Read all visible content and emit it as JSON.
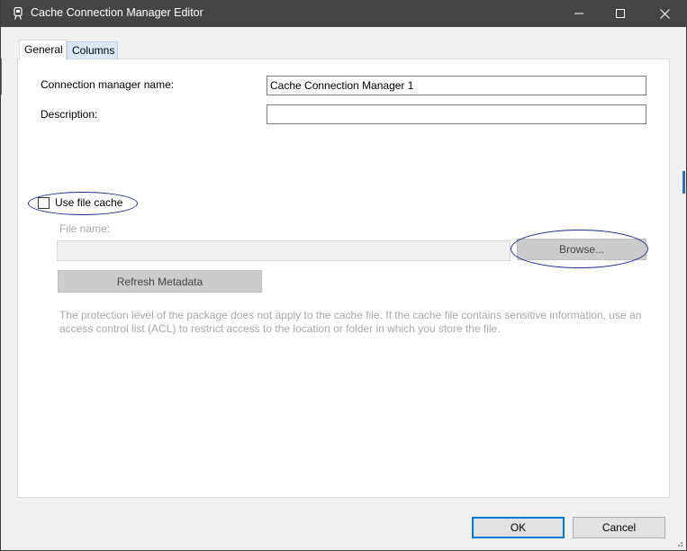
{
  "window": {
    "title": "Cache Connection Manager Editor"
  },
  "tabs": [
    {
      "label": "General",
      "selected": true
    },
    {
      "label": "Columns",
      "selected": false
    }
  ],
  "form": {
    "connection_name_label": "Connection manager name:",
    "connection_name_value": "Cache Connection Manager 1",
    "description_label": "Description:",
    "description_value": "",
    "use_file_cache_label": "Use file cache",
    "use_file_cache_checked": false,
    "file_name_label": "File name:",
    "file_name_value": "",
    "browse_label": "Browse...",
    "refresh_label": "Refresh Metadata",
    "info_text": "The protection level of the package does not apply to the cache file. If the cache file contains sensitive information, use an access control list (ACL) to restrict access to the location or folder in which you store the file."
  },
  "footer": {
    "ok_label": "OK",
    "cancel_label": "Cancel"
  },
  "colors": {
    "titlebar": "#444444",
    "ok_border": "#0078d7",
    "annotation": "#1f2a8a"
  },
  "icons": {
    "title": "cache-connection-icon",
    "minimize": "minimize-icon",
    "maximize": "maximize-icon",
    "close": "close-icon"
  }
}
